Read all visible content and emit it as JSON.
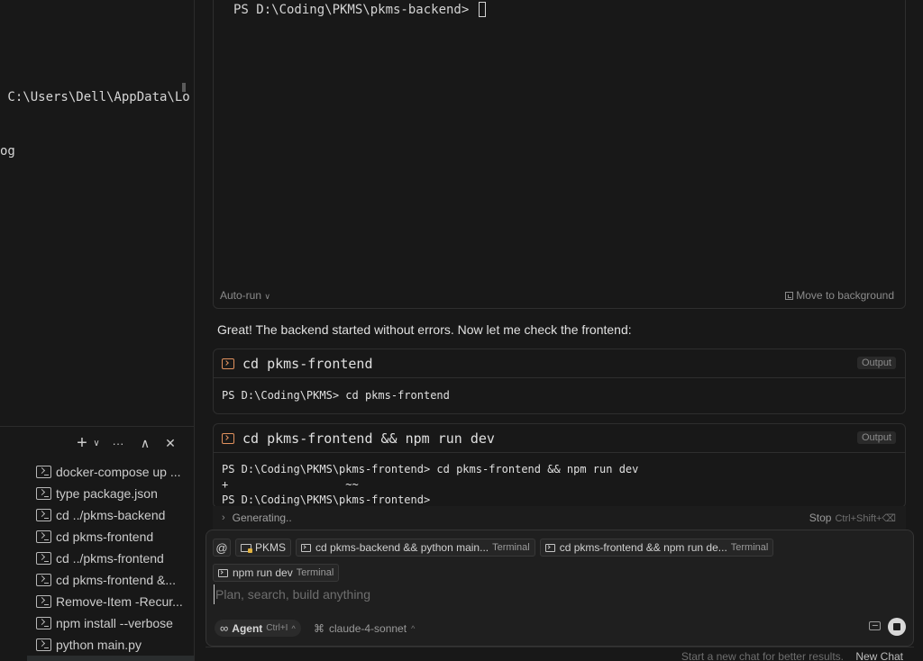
{
  "left_panel": {
    "terminal_lines": [
      " C:\\Users\\Dell\\AppData\\Loc",
      "og"
    ],
    "toolbar": {
      "add": "+",
      "add_chevron": "∨",
      "more": "···",
      "maximize": "∧",
      "close": "✕"
    },
    "tasks": [
      "docker-compose up ...",
      "type package.json",
      "cd ../pkms-backend",
      "cd pkms-frontend",
      "cd ../pkms-frontend",
      "cd pkms-frontend &...",
      "Remove-Item -Recur...",
      "npm install --verbose",
      "python main.py"
    ]
  },
  "terminal": {
    "prompt": "PS D:\\Coding\\PKMS\\pkms-backend> ",
    "auto_run": "Auto-run",
    "auto_run_chevron": "∨",
    "move_to_background": "Move to background"
  },
  "message": "Great! The backend started without errors. Now let me check the frontend:",
  "commands": [
    {
      "title": "cd pkms-frontend",
      "badge": "Output",
      "output": "PS D:\\Coding\\PKMS> cd pkms-frontend"
    },
    {
      "title": "cd pkms-frontend && npm run dev",
      "badge": "Output",
      "output": "PS D:\\Coding\\PKMS\\pkms-frontend> cd pkms-frontend && npm run dev\n+                  ~~\nPS D:\\Coding\\PKMS\\pkms-frontend>"
    }
  ],
  "generating": {
    "chevron": "›",
    "label": "Generating..",
    "stop": "Stop",
    "stop_shortcut": "Ctrl+Shift+⌫"
  },
  "composer": {
    "at_symbol": "@",
    "chips": [
      {
        "label": "PKMS",
        "sub": ""
      },
      {
        "label": "cd pkms-backend && python main...",
        "sub": "Terminal"
      },
      {
        "label": "cd pkms-frontend && npm run de...",
        "sub": "Terminal"
      },
      {
        "label": "npm run dev",
        "sub": "Terminal"
      }
    ],
    "placeholder": "Plan, search, build anything",
    "agent_icon": "∞",
    "agent_label": "Agent",
    "agent_shortcut": "Ctrl+I",
    "agent_chevron": "^",
    "model_icon": "⌘",
    "model": "claude-4-sonnet",
    "model_chevron": "^"
  },
  "footer": {
    "hint": "Start a new chat for better results.",
    "new_chat": "New Chat"
  }
}
